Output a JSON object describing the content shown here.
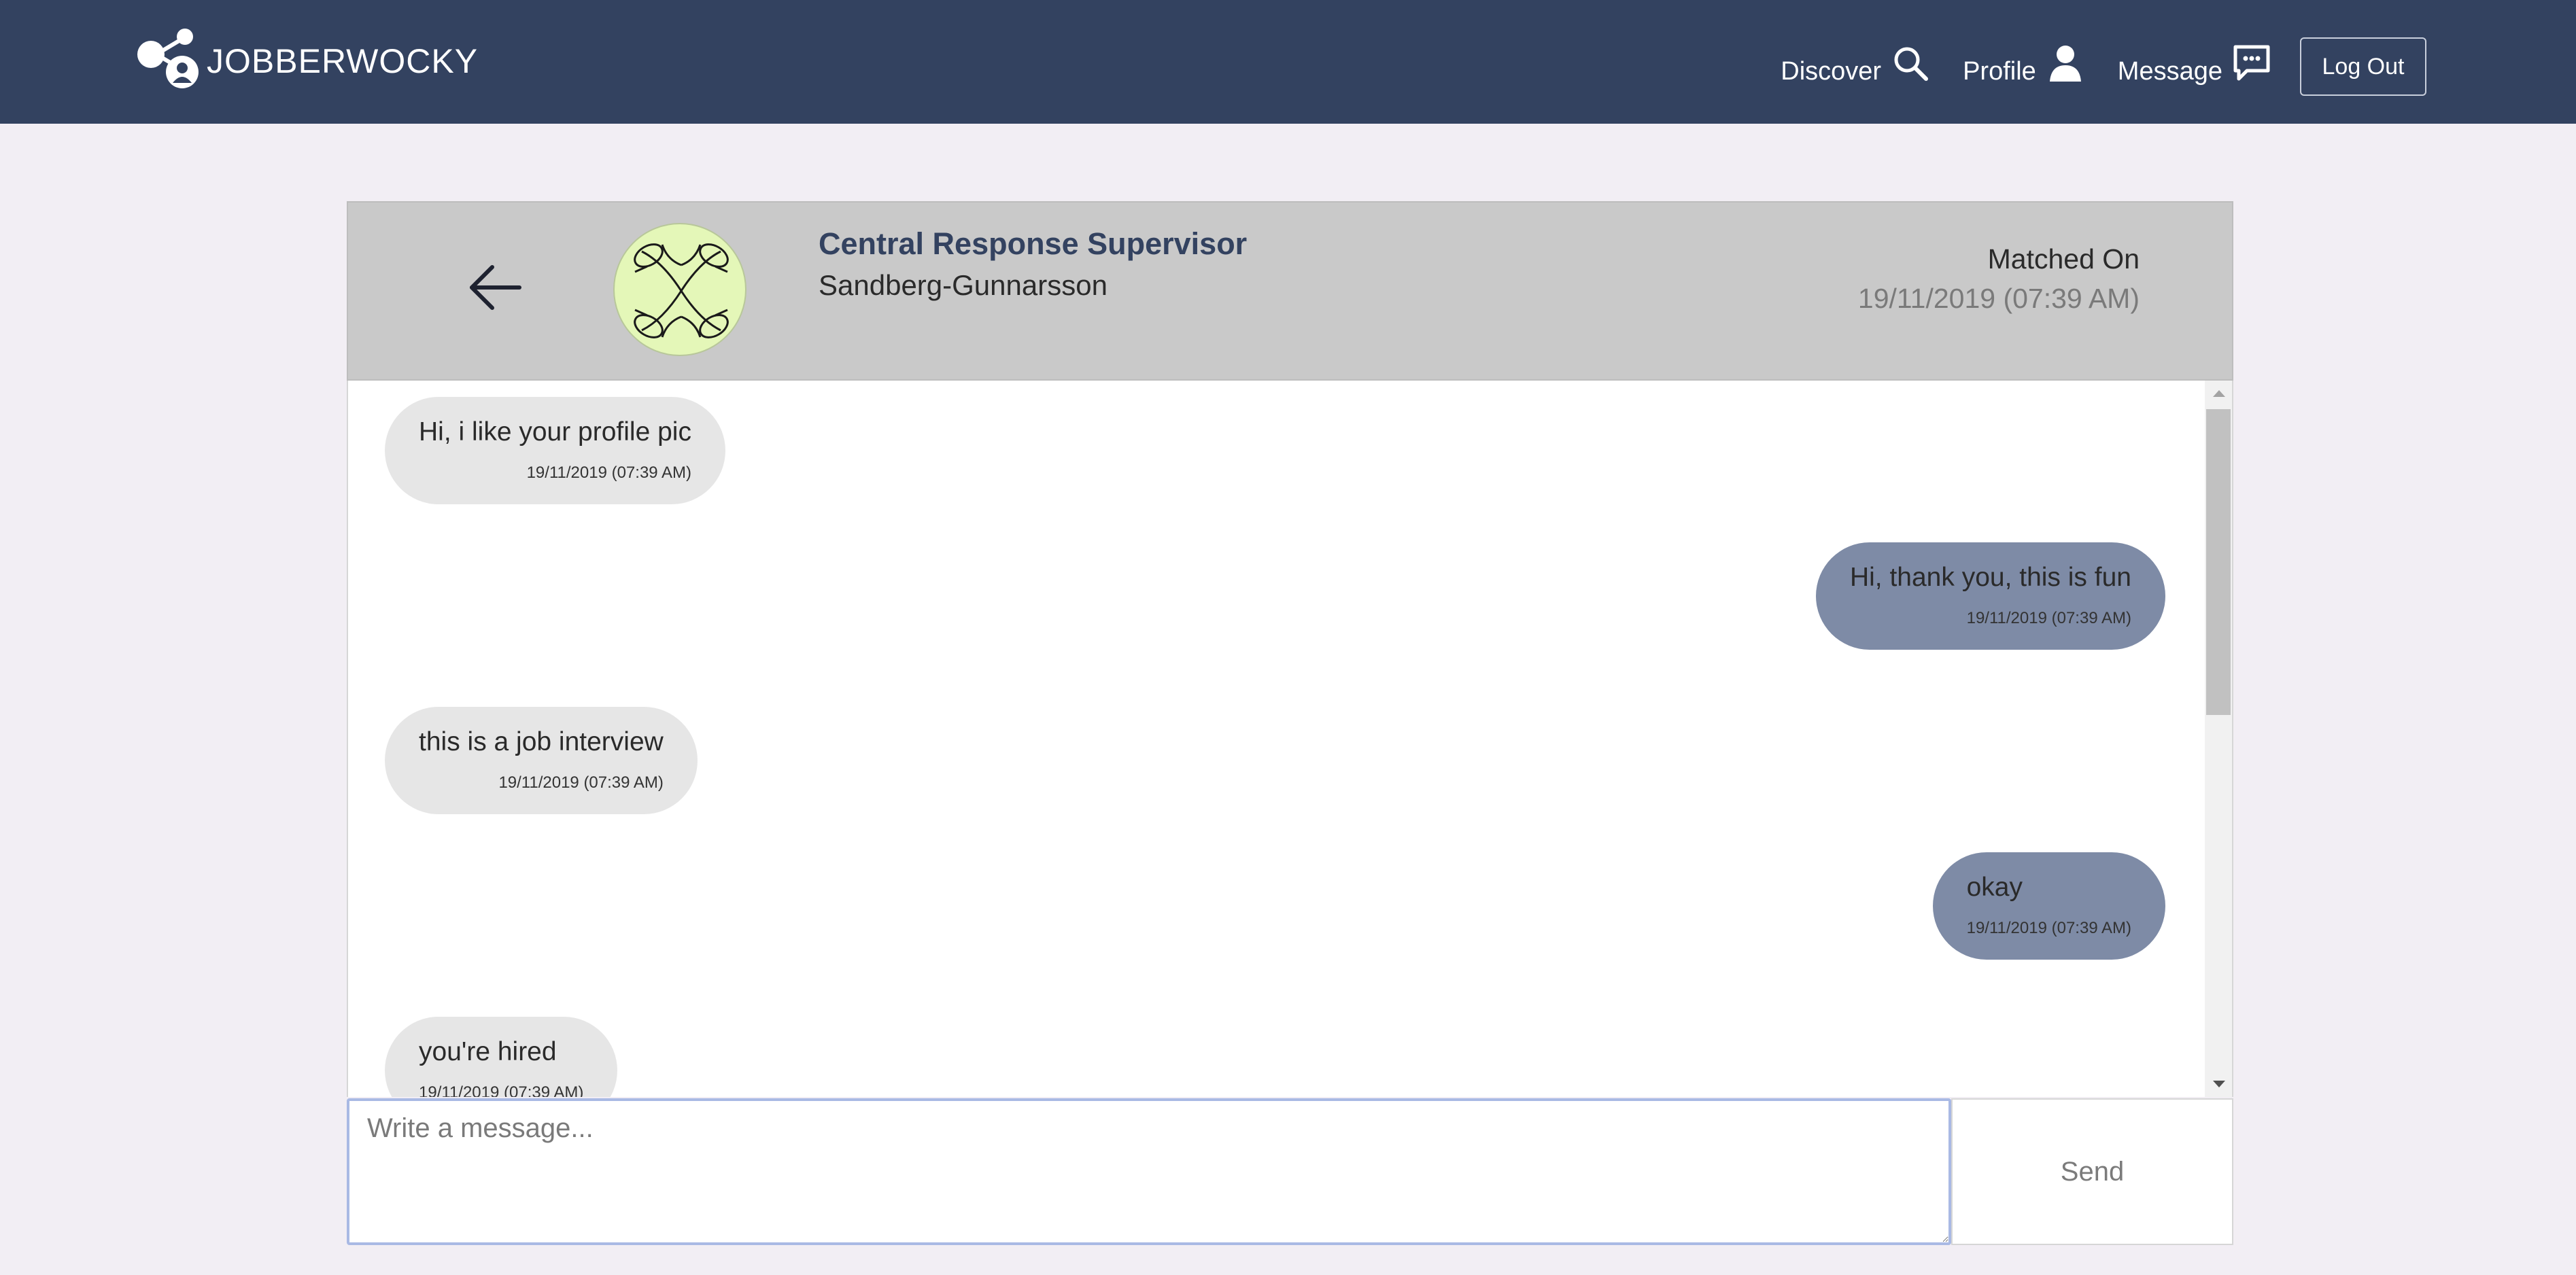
{
  "navbar": {
    "brand": "JOBBERWOCKY",
    "brand_icon": "share-person-logo-icon",
    "items": [
      {
        "label": "Discover",
        "icon": "search-icon"
      },
      {
        "label": "Profile",
        "icon": "person-icon"
      },
      {
        "label": "Message",
        "icon": "chat-bubble-icon"
      }
    ],
    "logout_label": "Log Out",
    "background_color": "#334260"
  },
  "chat": {
    "header": {
      "back_icon": "arrow-left-icon",
      "job_title": "Central Response Supervisor",
      "company": "Sandberg-Gunnarsson",
      "matched_label": "Matched On",
      "matched_date": "19/11/2019 (07:39 AM)"
    },
    "messages": [
      {
        "direction": "received",
        "text": "Hi, i like your profile pic",
        "time": "19/11/2019 (07:39 AM)"
      },
      {
        "direction": "sent",
        "text": "Hi, thank you, this is fun",
        "time": "19/11/2019 (07:39 AM)"
      },
      {
        "direction": "received",
        "text": "this is a job interview",
        "time": "19/11/2019 (07:39 AM)"
      },
      {
        "direction": "sent",
        "text": "okay",
        "time": "19/11/2019 (07:39 AM)"
      },
      {
        "direction": "received",
        "text": "you're hired",
        "time": "19/11/2019 (07:39 AM)"
      }
    ],
    "composer": {
      "placeholder": "Write a message...",
      "value": "",
      "send_label": "Send"
    },
    "colors": {
      "received_bubble": "#e6e6e6",
      "sent_bubble": "#7e8ba6",
      "header_bg": "#c9c9c9"
    }
  }
}
